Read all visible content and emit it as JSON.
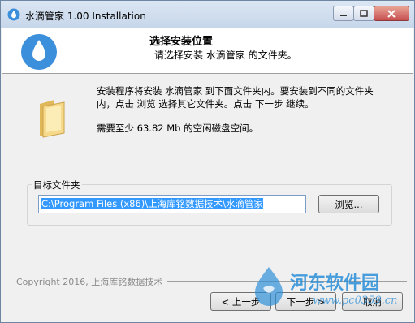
{
  "window": {
    "title": "水滴管家 1.00 Installation",
    "icon": "water-drop-icon"
  },
  "header": {
    "title": "选择安装位置",
    "subtitle": "请选择安装 水滴管家 的文件夹。",
    "icon": "water-drop-icon",
    "accent": "#3b8fdb"
  },
  "body": {
    "description": "安装程序将安装 水滴管家 到下面文件夹内。要安装到不同的文件夹内，点击 浏览 选择其它文件夹。点击 下一步 继续。",
    "space_required": "需要至少 63.82 Mb 的空闲磁盘空间。",
    "folder_icon": "folder-icon"
  },
  "destination": {
    "group_label": "目标文件夹",
    "path": "C:\\Program Files (x86)\\上海库铭数据技术\\水滴管家",
    "browse_label": "浏览..."
  },
  "footer": {
    "copyright": "Copyright 2016, 上海库铭数据技术",
    "back_label": "< 上一步",
    "next_label": "下一步 >",
    "cancel_label": "取消"
  },
  "watermark": {
    "text": "河东软件园",
    "url": "www.pc0359.cn"
  }
}
